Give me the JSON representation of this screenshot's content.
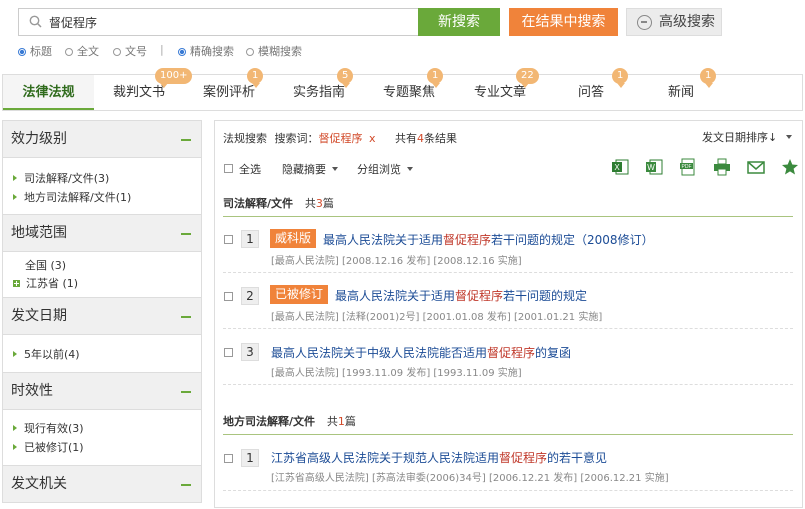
{
  "search": {
    "query": "督促程序",
    "new_search": "新搜索",
    "search_in_results": "在结果中搜索",
    "advanced_search": "高级搜索",
    "scope_options": [
      "标题",
      "全文",
      "文号"
    ],
    "scope_selected": "标题",
    "separator": "|",
    "match_options": [
      "精确搜索",
      "模糊搜索"
    ],
    "match_selected": "精确搜索"
  },
  "tabs": [
    {
      "label": "法律法规",
      "badge": "",
      "active": true
    },
    {
      "label": "裁判文书",
      "badge": "100+"
    },
    {
      "label": "案例评析",
      "badge": "1"
    },
    {
      "label": "实务指南",
      "badge": "5"
    },
    {
      "label": "专题聚焦",
      "badge": "1"
    },
    {
      "label": "专业文章",
      "badge": "22"
    },
    {
      "label": "问答",
      "badge": "1"
    },
    {
      "label": "新闻",
      "badge": "1"
    }
  ],
  "sidebar": {
    "sections": [
      {
        "title": "效力级别",
        "items": [
          "司法解释/文件(3)",
          "地方司法解释/文件(1)"
        ]
      },
      {
        "title": "地域范围",
        "items": [
          "全国 (3)",
          "江苏省 (1)"
        ]
      },
      {
        "title": "发文日期",
        "items": [
          "5年以前(4)"
        ]
      },
      {
        "title": "时效性",
        "items": [
          "现行有效(3)",
          "已被修订(1)"
        ]
      },
      {
        "title": "发文机关",
        "items": []
      }
    ]
  },
  "results_header": {
    "category": "法规搜索",
    "keyword_label": "搜索词：",
    "keyword": "督促程序",
    "remove": "x",
    "total_prefix": "共有",
    "total": "4",
    "total_suffix": "条结果",
    "sort_label": "发文日期排序↓"
  },
  "toolbar": {
    "select_all": "全选",
    "hide_summary": "隐藏摘要",
    "group_browse": "分组浏览"
  },
  "groups": [
    {
      "title": "司法解释/文件",
      "count_prefix": "共",
      "count": "3",
      "count_suffix": "篇",
      "results": [
        {
          "num": "1",
          "tag": "威科版",
          "title_pre": "最高人民法院关于适用",
          "title_hl": "督促程序",
          "title_post": "若干问题的规定（2008修订）",
          "meta": "[最高人民法院] [2008.12.16 发布] [2008.12.16 实施]"
        },
        {
          "num": "2",
          "tag": "已被修订",
          "title_pre": "最高人民法院关于适用",
          "title_hl": "督促程序",
          "title_post": "若干问题的规定",
          "meta": "[最高人民法院] [法释(2001)2号] [2001.01.08 发布] [2001.01.21 实施]"
        },
        {
          "num": "3",
          "tag": "",
          "title_pre": "最高人民法院关于中级人民法院能否适用",
          "title_hl": "督促程序",
          "title_post": "的复函",
          "meta": "[最高人民法院] [1993.11.09 发布] [1993.11.09 实施]"
        }
      ]
    },
    {
      "title": "地方司法解释/文件",
      "count_prefix": "共",
      "count": "1",
      "count_suffix": "篇",
      "results": [
        {
          "num": "1",
          "tag": "",
          "title_pre": "江苏省高级人民法院关于规范人民法院适用",
          "title_hl": "督促程序",
          "title_post": "的若干意见",
          "meta": "[江苏省高级人民法院] [苏高法审委(2006)34号] [2006.12.21 发布] [2006.12.21 实施]"
        }
      ]
    }
  ],
  "colors": {
    "green": "#6aa93a",
    "orange": "#f0833a",
    "link": "#1c4c96",
    "highlight": "#d24a2a"
  }
}
